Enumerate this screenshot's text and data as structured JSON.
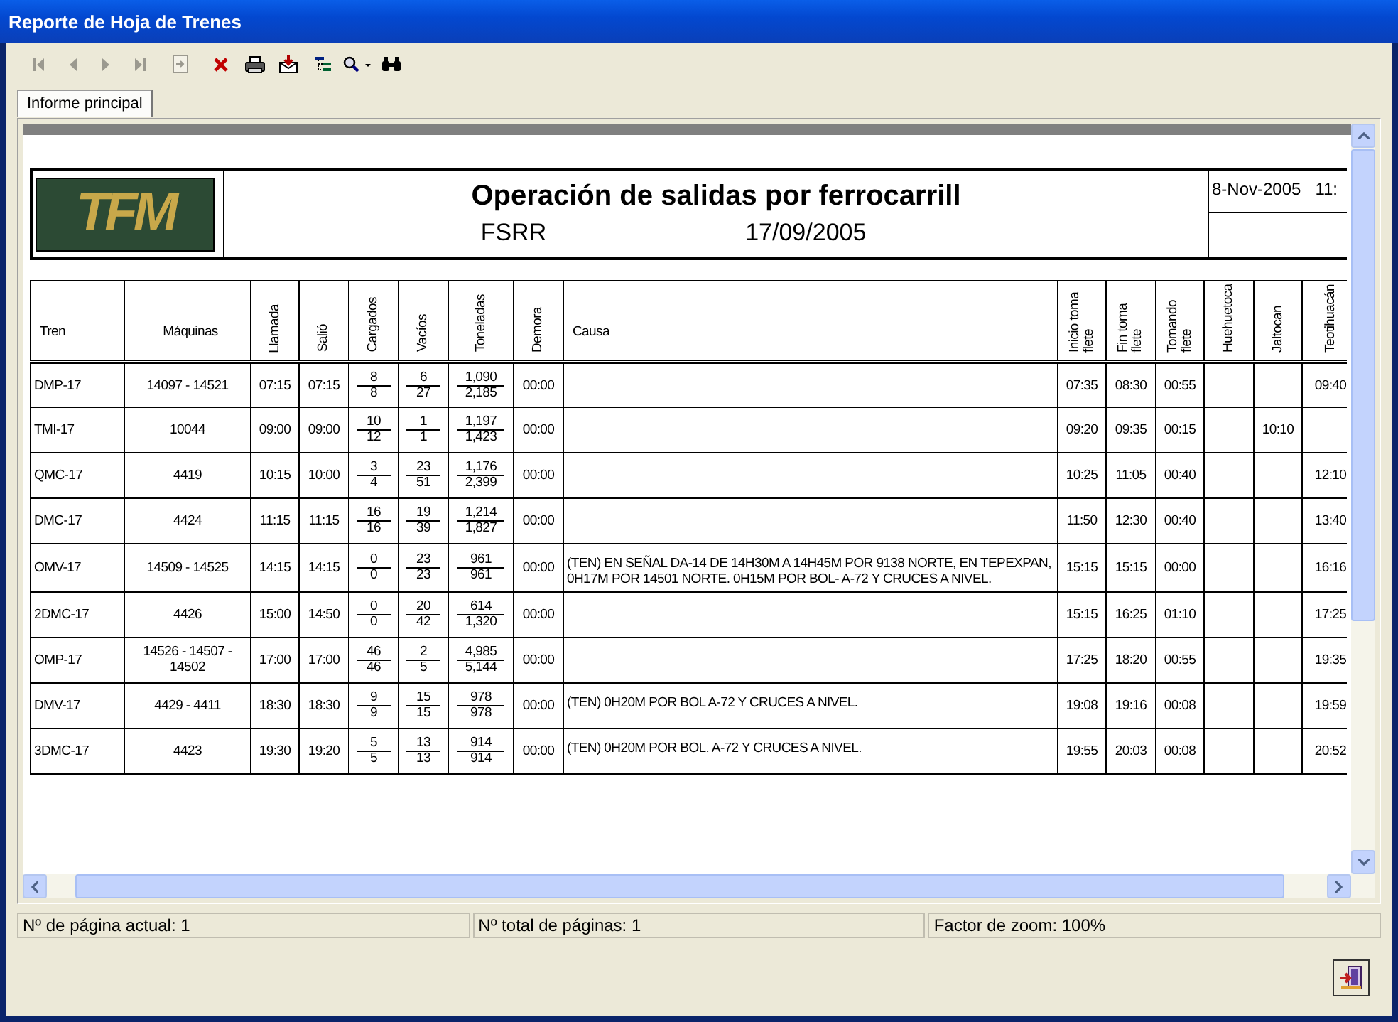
{
  "window": {
    "title": "Reporte de Hoja de Trenes"
  },
  "toolbar": [
    {
      "kind": "first",
      "disabled": true
    },
    {
      "kind": "prev",
      "disabled": true
    },
    {
      "kind": "next",
      "disabled": true
    },
    {
      "kind": "last",
      "disabled": true
    },
    {
      "kind": "goto",
      "disabled": true
    },
    {
      "kind": "close",
      "disabled": false
    },
    {
      "kind": "print",
      "disabled": false
    },
    {
      "kind": "export",
      "disabled": false
    },
    {
      "kind": "tree",
      "disabled": false
    },
    {
      "kind": "zoom",
      "disabled": false
    },
    {
      "kind": "find",
      "disabled": false
    }
  ],
  "tabs": [
    {
      "label": "Informe principal",
      "selected": true
    }
  ],
  "report": {
    "logo": "TFM",
    "title": "Operación de salidas por ferrocarrill",
    "code": "FSRR",
    "date": "17/09/2005",
    "printed": "8-Nov-2005   11:",
    "columns": [
      {
        "label": "Tren",
        "kind": "flat"
      },
      {
        "label": "Máquinas",
        "kind": "flat"
      },
      {
        "label": "Llamada",
        "kind": "rotated"
      },
      {
        "label": "Salió",
        "kind": "rotated"
      },
      {
        "label": "Cargados",
        "kind": "rotated"
      },
      {
        "label": "Vacíos",
        "kind": "rotated"
      },
      {
        "label": "Toneladas",
        "kind": "rotated"
      },
      {
        "label": "Demora",
        "kind": "rotated"
      },
      {
        "label": "Causa",
        "kind": "flat"
      },
      {
        "label": "Inicio toma flete",
        "kind": "rotated"
      },
      {
        "label": "Fin toma flete",
        "kind": "rotated"
      },
      {
        "label": "Tomando flete",
        "kind": "rotated"
      },
      {
        "label": "Huehuetoca",
        "kind": "rotated"
      },
      {
        "label": "Jaltocan",
        "kind": "rotated"
      },
      {
        "label": "Teotihuacán",
        "kind": "rotated"
      }
    ],
    "rows": [
      {
        "cells": [
          "DMP-17",
          "14097 - 14521",
          "07:15",
          "07:15",
          {
            "numerator": "8",
            "denominator": "8"
          },
          {
            "numerator": "6",
            "denominator": "27"
          },
          {
            "numerator": "1,090",
            "denominator": "2,185"
          },
          "00:00",
          null,
          "07:35",
          "08:30",
          "00:55",
          null,
          null,
          "09:40"
        ]
      },
      {
        "cells": [
          "TMI-17",
          "10044",
          "09:00",
          "09:00",
          {
            "numerator": "10",
            "denominator": "12"
          },
          {
            "numerator": "1",
            "denominator": "1"
          },
          {
            "numerator": "1,197",
            "denominator": "1,423"
          },
          "00:00",
          null,
          "09:20",
          "09:35",
          "00:15",
          null,
          "10:10",
          null
        ]
      },
      {
        "cells": [
          "QMC-17",
          "4419",
          "10:15",
          "10:00",
          {
            "numerator": "3",
            "denominator": "4"
          },
          {
            "numerator": "23",
            "denominator": "51"
          },
          {
            "numerator": "1,176",
            "denominator": "2,399"
          },
          "00:00",
          null,
          "10:25",
          "11:05",
          "00:40",
          null,
          null,
          "12:10"
        ]
      },
      {
        "cells": [
          "DMC-17",
          "4424",
          "11:15",
          "11:15",
          {
            "numerator": "16",
            "denominator": "16"
          },
          {
            "numerator": "19",
            "denominator": "39"
          },
          {
            "numerator": "1,214",
            "denominator": "1,827"
          },
          "00:00",
          null,
          "11:50",
          "12:30",
          "00:40",
          null,
          null,
          "13:40"
        ]
      },
      {
        "cells": [
          "OMV-17",
          "14509 - 14525",
          "14:15",
          "14:15",
          {
            "numerator": "0",
            "denominator": "0"
          },
          {
            "numerator": "23",
            "denominator": "23"
          },
          {
            "numerator": "961",
            "denominator": "961"
          },
          "00:00",
          "(TEN) EN SEÑAL DA-14 DE 14H30M A 14H45M POR 9138 NORTE, EN TEPEXPAN, 0H17M POR 14501 NORTE.   0H15M POR BOL- A-72 Y CRUCES A NIVEL.",
          "15:15",
          "15:15",
          "00:00",
          null,
          null,
          "16:16"
        ]
      },
      {
        "cells": [
          "2DMC-17",
          "4426",
          "15:00",
          "14:50",
          {
            "numerator": "0",
            "denominator": "0"
          },
          {
            "numerator": "20",
            "denominator": "42"
          },
          {
            "numerator": "614",
            "denominator": "1,320"
          },
          "00:00",
          null,
          "15:15",
          "16:25",
          "01:10",
          null,
          null,
          "17:25"
        ]
      },
      {
        "cells": [
          "OMP-17",
          "14526 - 14507 - 14502",
          "17:00",
          "17:00",
          {
            "numerator": "46",
            "denominator": "46"
          },
          {
            "numerator": "2",
            "denominator": "5"
          },
          {
            "numerator": "4,985",
            "denominator": "5,144"
          },
          "00:00",
          null,
          "17:25",
          "18:20",
          "00:55",
          null,
          null,
          "19:35"
        ]
      },
      {
        "cells": [
          "DMV-17",
          "4429 - 4411",
          "18:30",
          "18:30",
          {
            "numerator": "9",
            "denominator": "9"
          },
          {
            "numerator": "15",
            "denominator": "15"
          },
          {
            "numerator": "978",
            "denominator": "978"
          },
          "00:00",
          "(TEN) 0H20M POR BOL  A-72 Y CRUCES  A NIVEL.",
          "19:08",
          "19:16",
          "00:08",
          null,
          null,
          "19:59"
        ]
      },
      {
        "cells": [
          "3DMC-17",
          "4423",
          "19:30",
          "19:20",
          {
            "numerator": "5",
            "denominator": "5"
          },
          {
            "numerator": "13",
            "denominator": "13"
          },
          {
            "numerator": "914",
            "denominator": "914"
          },
          "00:00",
          "(TEN) 0H20M POR BOL. A-72 Y CRUCES  A NIVEL.",
          "19:55",
          "20:03",
          "00:08",
          null,
          null,
          "20:52"
        ]
      }
    ]
  },
  "status_bar": [
    "Nº de página actual: 1",
    "Nº total de páginas: 1",
    "Factor de zoom: 100%"
  ]
}
